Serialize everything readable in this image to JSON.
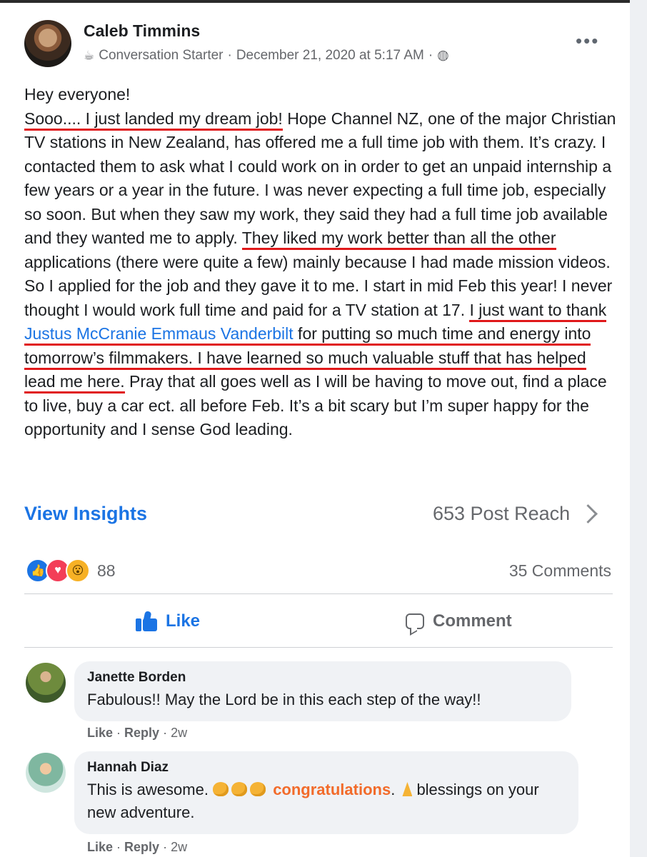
{
  "post": {
    "author": "Caleb Timmins",
    "badge_icon": "coffee-cup-icon",
    "badge": "Conversation Starter",
    "timestamp": "December 21, 2020 at 5:17 AM",
    "privacy_icon": "globe-icon",
    "more_label": "•••",
    "greeting": "Hey everyone!",
    "text": {
      "s1": "Sooo.... I just landed my dream job!",
      "s2": " Hope Channel NZ, one of the major Christian TV stations in New Zealand, has offered me a full time job with them. It’s crazy. I contacted them to ask what I could work on in order to get an unpaid internship a few years or a year in the future. I was never expecting a full time job, especially so soon. But when they saw my work, they said they had a full time job available and they wanted me to apply. ",
      "s3": "They liked my work better than all the other",
      "s4": " applications (there were quite a few) mainly because I had made mission videos. So I applied for the job and they gave it to me. I start in mid Feb this year! I never thought I would work full time and paid for a TV station at 17. ",
      "s5": "I just want to thank ",
      "mention1": "Justus McCranie",
      "mention2": "Emmaus Vanderbilt",
      "s6": " for putting so much time and energy into tomorrow’s filmmakers. I have learned so much valuable stuff that has helped lead me here.",
      "s7": " Pray that all goes well as I will be having to move out, find a place to live, buy a car ect. all before Feb. It’s a bit scary but I’m super happy for the opportunity and I sense God leading."
    }
  },
  "insights": {
    "label": "View Insights",
    "reach": "653 Post Reach"
  },
  "reactions": {
    "icons": [
      "like-icon",
      "love-icon",
      "wow-icon"
    ],
    "count": "88",
    "comments": "35 Comments"
  },
  "actions": {
    "like": "Like",
    "comment": "Comment"
  },
  "comments": [
    {
      "name": "Janette Borden",
      "text": "Fabulous!! May the Lord be in this each step of the way!!",
      "like": "Like",
      "sep": " · ",
      "reply": "Reply",
      "time": "2w"
    },
    {
      "name": "Hannah Diaz",
      "text_a": "This is awesome. ",
      "highlight": "congratulations",
      "text_b": ". ",
      "text_c": "blessings on your new adventure.",
      "like": "Like",
      "sep": " · ",
      "reply": "Reply",
      "time": "2w"
    }
  ],
  "colors": {
    "link": "#1b74e4",
    "underline": "#e0181a",
    "highlight": "#f26b2a"
  }
}
